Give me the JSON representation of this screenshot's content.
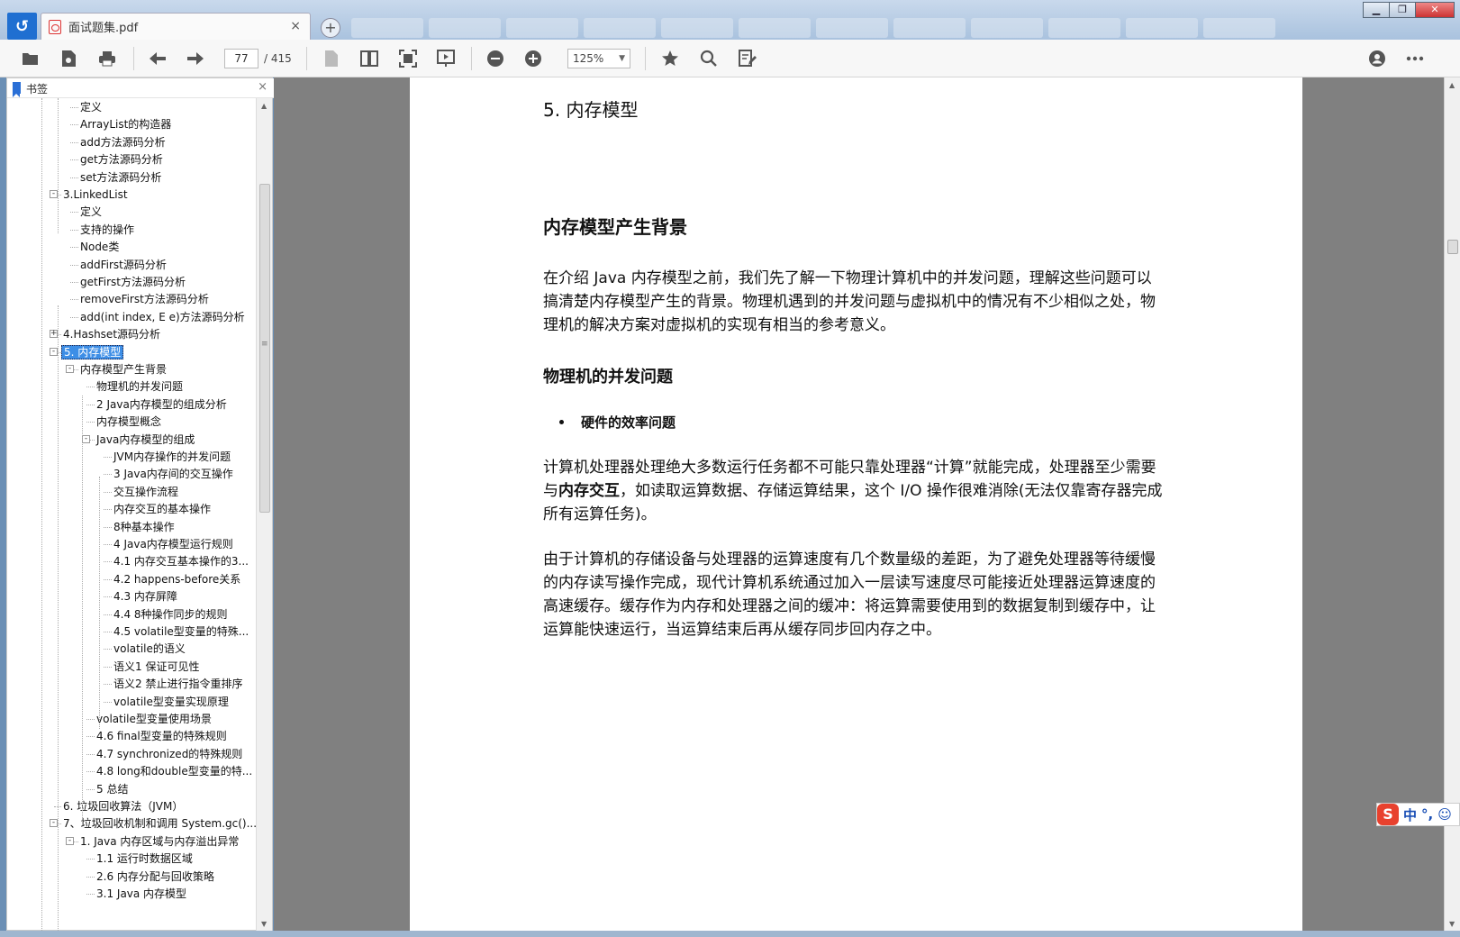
{
  "window": {
    "tab_title": "面试题集.pdf",
    "tab_close": "×",
    "new_tab": "+",
    "controls": {
      "minimize": "▁",
      "maximize": "❐",
      "close": "✕"
    }
  },
  "toolbar": {
    "current_page": "77",
    "total_pages": "/ 415",
    "zoom": "125%"
  },
  "bookmarks": {
    "title": "书签",
    "close": "×",
    "items": [
      {
        "label": "定义",
        "level": 2
      },
      {
        "label": "ArrayList的构造器",
        "level": 2
      },
      {
        "label": "add方法源码分析",
        "level": 2
      },
      {
        "label": "get方法源码分析",
        "level": 2
      },
      {
        "label": "set方法源码分析",
        "level": 2
      },
      {
        "label": "3.LinkedList",
        "level": 1,
        "toggle": "-"
      },
      {
        "label": "定义",
        "level": 2
      },
      {
        "label": "支持的操作",
        "level": 2
      },
      {
        "label": "Node类",
        "level": 2
      },
      {
        "label": "addFirst源码分析",
        "level": 2
      },
      {
        "label": "getFirst方法源码分析",
        "level": 2
      },
      {
        "label": "removeFirst方法源码分析",
        "level": 2
      },
      {
        "label": "add(int index, E e)方法源码分析",
        "level": 2
      },
      {
        "label": "4.Hashset源码分析",
        "level": 1,
        "toggle": "+"
      },
      {
        "label": "5. 内存模型",
        "level": 1,
        "toggle": "-",
        "selected": true
      },
      {
        "label": "内存模型产生背景",
        "level": 2,
        "toggle": "-"
      },
      {
        "label": "物理机的并发问题",
        "level": 3
      },
      {
        "label": "2 Java内存模型的组成分析",
        "level": 3
      },
      {
        "label": "内存模型概念",
        "level": 3
      },
      {
        "label": "Java内存模型的组成",
        "level": 3,
        "toggle": "-"
      },
      {
        "label": "JVM内存操作的并发问题",
        "level": 4
      },
      {
        "label": "3 Java内存间的交互操作",
        "level": 4
      },
      {
        "label": "交互操作流程",
        "level": 4
      },
      {
        "label": "内存交互的基本操作",
        "level": 4
      },
      {
        "label": "8种基本操作",
        "level": 4
      },
      {
        "label": "4 Java内存模型运行规则",
        "level": 4
      },
      {
        "label": "4.1 内存交互基本操作的3...",
        "level": 4
      },
      {
        "label": "4.2 happens-before关系",
        "level": 4
      },
      {
        "label": "4.3 内存屏障",
        "level": 4
      },
      {
        "label": "4.4 8种操作同步的规则",
        "level": 4
      },
      {
        "label": "4.5 volatile型变量的特殊...",
        "level": 4
      },
      {
        "label": "volatile的语义",
        "level": 4
      },
      {
        "label": "语义1 保证可见性",
        "level": 4
      },
      {
        "label": "语义2 禁止进行指令重排序",
        "level": 4
      },
      {
        "label": "volatile型变量实现原理",
        "level": 4
      },
      {
        "label": "volatile型变量使用场景",
        "level": 3
      },
      {
        "label": "4.6 final型变量的特殊规则",
        "level": 3
      },
      {
        "label": "4.7 synchronized的特殊规则",
        "level": 3
      },
      {
        "label": "4.8 long和double型变量的特...",
        "level": 3
      },
      {
        "label": "5 总结",
        "level": 3
      },
      {
        "label": "6. 垃圾回收算法（JVM）",
        "level": 1
      },
      {
        "label": "7、垃圾回收机制和调用 System.gc()...",
        "level": 1,
        "toggle": "-"
      },
      {
        "label": "1. Java 内存区域与内存溢出异常",
        "level": 2,
        "toggle": "-"
      },
      {
        "label": "1.1 运行时数据区域",
        "level": 3
      },
      {
        "label": "2.6 内存分配与回收策略",
        "level": 3
      },
      {
        "label": "3.1 Java 内存模型",
        "level": 3
      }
    ]
  },
  "document": {
    "title": "5.  内存模型",
    "section_heading": "内存模型产生背景",
    "para1": "在介绍 Java 内存模型之前，我们先了解一下物理计算机中的并发问题，理解这些问题可以搞清楚内存模型产生的背景。物理机遇到的并发问题与虚拟机中的情况有不少相似之处，物理机的解决方案对虚拟机的实现有相当的参考意义。",
    "subheading": "物理机的并发问题",
    "bullet": "硬件的效率问题",
    "para2_a": "计算机处理器处理绝大多数运行任务都不可能只靠处理器“计算”就能完成，处理器至少需要与",
    "para2_bold": "内存交互",
    "para2_b": "，如读取运算数据、存储运算结果，这个 I/O 操作很难消除(无法仅靠寄存器完成所有运算任务)。",
    "para3": "由于计算机的存储设备与处理器的运算速度有几个数量级的差距，为了避免处理器等待缓慢的内存读写操作完成，现代计算机系统通过加入一层读写速度尽可能接近处理器运算速度的高速缓存。缓存作为内存和处理器之间的缓冲：将运算需要使用到的数据复制到缓存中，让运算能快速运行，当运算结束后再从缓存同步回内存之中。"
  },
  "ime": {
    "logo": "S",
    "mode": "中",
    "punct": "°,",
    "emoji": "☺"
  }
}
